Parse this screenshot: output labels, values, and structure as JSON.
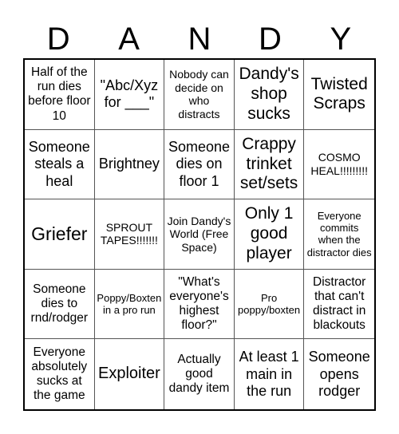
{
  "title_letters": [
    "D",
    "A",
    "N",
    "D",
    "Y"
  ],
  "cells": [
    "Half of the run dies before floor 10",
    "\"Abc/Xyz for ___\"",
    "Nobody can decide on who distracts",
    "Dandy's shop sucks",
    "Twisted Scraps",
    "Someone steals a heal",
    "Brightney",
    "Someone dies on floor 1",
    "Crappy trinket set/sets",
    "COSMO HEAL!!!!!!!!!",
    "Griefer",
    "SPROUT TAPES!!!!!!!",
    "Join Dandy's World (Free Space)",
    "Only 1 good player",
    "Everyone commits when the distractor dies",
    "Someone dies to rnd/rodger",
    "Poppy/Boxten in a pro run",
    "\"What's everyone's highest floor?\"",
    "Pro poppy/boxten",
    "Distractor that can't distract in blackouts",
    "Everyone absolutely sucks at the game",
    "Exploiter",
    "Actually good dandy item",
    "At least 1 main in the run",
    "Someone opens rodger"
  ],
  "free_space_index": 12,
  "colors": {
    "background": "#ffffff",
    "text": "#000000",
    "grid_line": "#555555"
  }
}
